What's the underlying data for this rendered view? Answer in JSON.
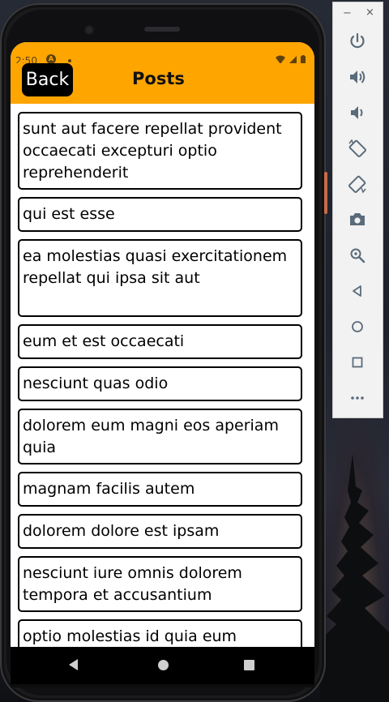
{
  "status_bar": {
    "time": "2:50",
    "notification_icon": "A"
  },
  "header": {
    "back_label": "Back",
    "title": "Posts"
  },
  "posts": [
    "sunt aut facere repellat provident occaecati excepturi optio reprehenderit",
    "qui est esse",
    "ea molestias quasi exercitationem repellat qui ipsa sit aut",
    "eum et est occaecati",
    "nesciunt quas odio",
    "dolorem eum magni eos aperiam quia",
    "magnam facilis autem",
    "dolorem dolore est ipsam",
    "nesciunt iure omnis dolorem tempora et accusantium",
    "optio molestias id quia eum"
  ],
  "emulator_toolbar": {
    "minimize_label": "−",
    "close_label": "×",
    "buttons": [
      "power-icon",
      "volume-up-icon",
      "volume-down-icon",
      "rotate-left-icon",
      "rotate-right-icon",
      "camera-icon",
      "zoom-icon",
      "back-triangle-icon",
      "home-circle-icon",
      "overview-square-icon",
      "more-icon"
    ]
  },
  "colors": {
    "header_bg": "#ffa500",
    "back_button_bg": "#000000"
  }
}
